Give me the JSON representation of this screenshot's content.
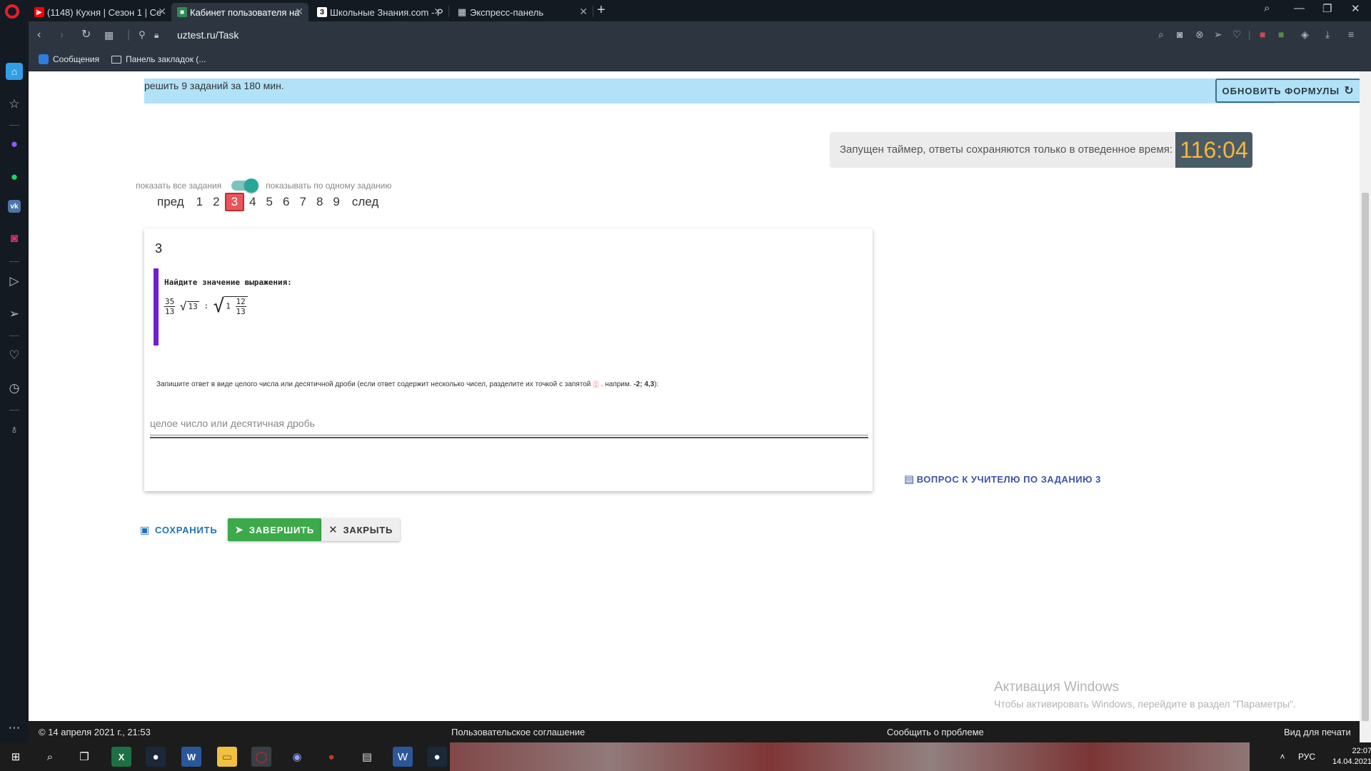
{
  "browser": {
    "tabs": [
      {
        "title": "(1148) Кухня | Сезон 1 | Се",
        "icon": "youtube-icon",
        "active": false
      },
      {
        "title": "Кабинет пользователя на",
        "icon": "uztest-icon",
        "active": true
      },
      {
        "title": "Школьные Знания.com - Р",
        "icon": "znania-icon",
        "active": false
      },
      {
        "title": "Экспресс-панель",
        "icon": "speed-dial-icon",
        "active": false
      }
    ],
    "url": "uztest.ru/Task",
    "bookmarks": [
      {
        "label": "Сообщения",
        "icon": "messages-icon"
      },
      {
        "label": "Панель закладок (...",
        "icon": "folder-icon"
      }
    ]
  },
  "page": {
    "banner_text": "решить 9 заданий за 180 мин.",
    "refresh_button": "ОБНОВИТЬ ФОРМУЛЫ",
    "timer_label": "Запущен таймер, ответы сохраняются только в отведенное время:",
    "timer_value": "116:04",
    "mode_left": "показать все задания",
    "mode_right": "показывать по одному заданию",
    "pager": {
      "prev": "пред",
      "next": "след",
      "pages": [
        "1",
        "2",
        "3",
        "4",
        "5",
        "6",
        "7",
        "8",
        "9"
      ],
      "current": "3"
    },
    "task": {
      "number": "3",
      "prompt": "Найдите значение выражения:",
      "formula": {
        "frac1_num": "35",
        "frac1_den": "13",
        "sqrt_inner": "13",
        "op": ":",
        "whole": "1",
        "frac2_num": "12",
        "frac2_den": "13"
      },
      "hint_before": "Запишите ответ в виде целого числа или десятичной дроби (если ответ содержит несколько чисел, разделите их точкой с запятой",
      "hint_sep": ";",
      "hint_after": ". наприм.",
      "hint_example": "-2; 4,3",
      "hint_end": "):",
      "answer_placeholder": "целое число или десятичная дробь",
      "answer_value": ""
    },
    "teacher_question": "ВОПРОС К УЧИТЕЛЮ ПО ЗАДАНИЮ 3",
    "actions": {
      "save": "СОХРАНИТЬ",
      "finish": "ЗАВЕРШИТЬ",
      "close": "ЗАКРЫТЬ"
    },
    "watermark": {
      "title": "Активация Windows",
      "subtitle": "Чтобы активировать Windows, перейдите в раздел \"Параметры\"."
    },
    "footer": {
      "copyright": "© 14 апреля 2021 г., 21:53",
      "agreement": "Пользовательское соглашение",
      "report": "Сообщить о проблеме",
      "print": "Вид для печати"
    }
  },
  "taskbar": {
    "language": "РУС",
    "time": "22:07",
    "date": "14.04.2021"
  },
  "colors": {
    "banner": "#b2e2f7",
    "current_page": "#e8565a",
    "task_accent": "#6f1fd1",
    "finish_button": "#3caa4a",
    "timer_digits": "#f5b63b",
    "link_blue": "#3d53a6"
  }
}
